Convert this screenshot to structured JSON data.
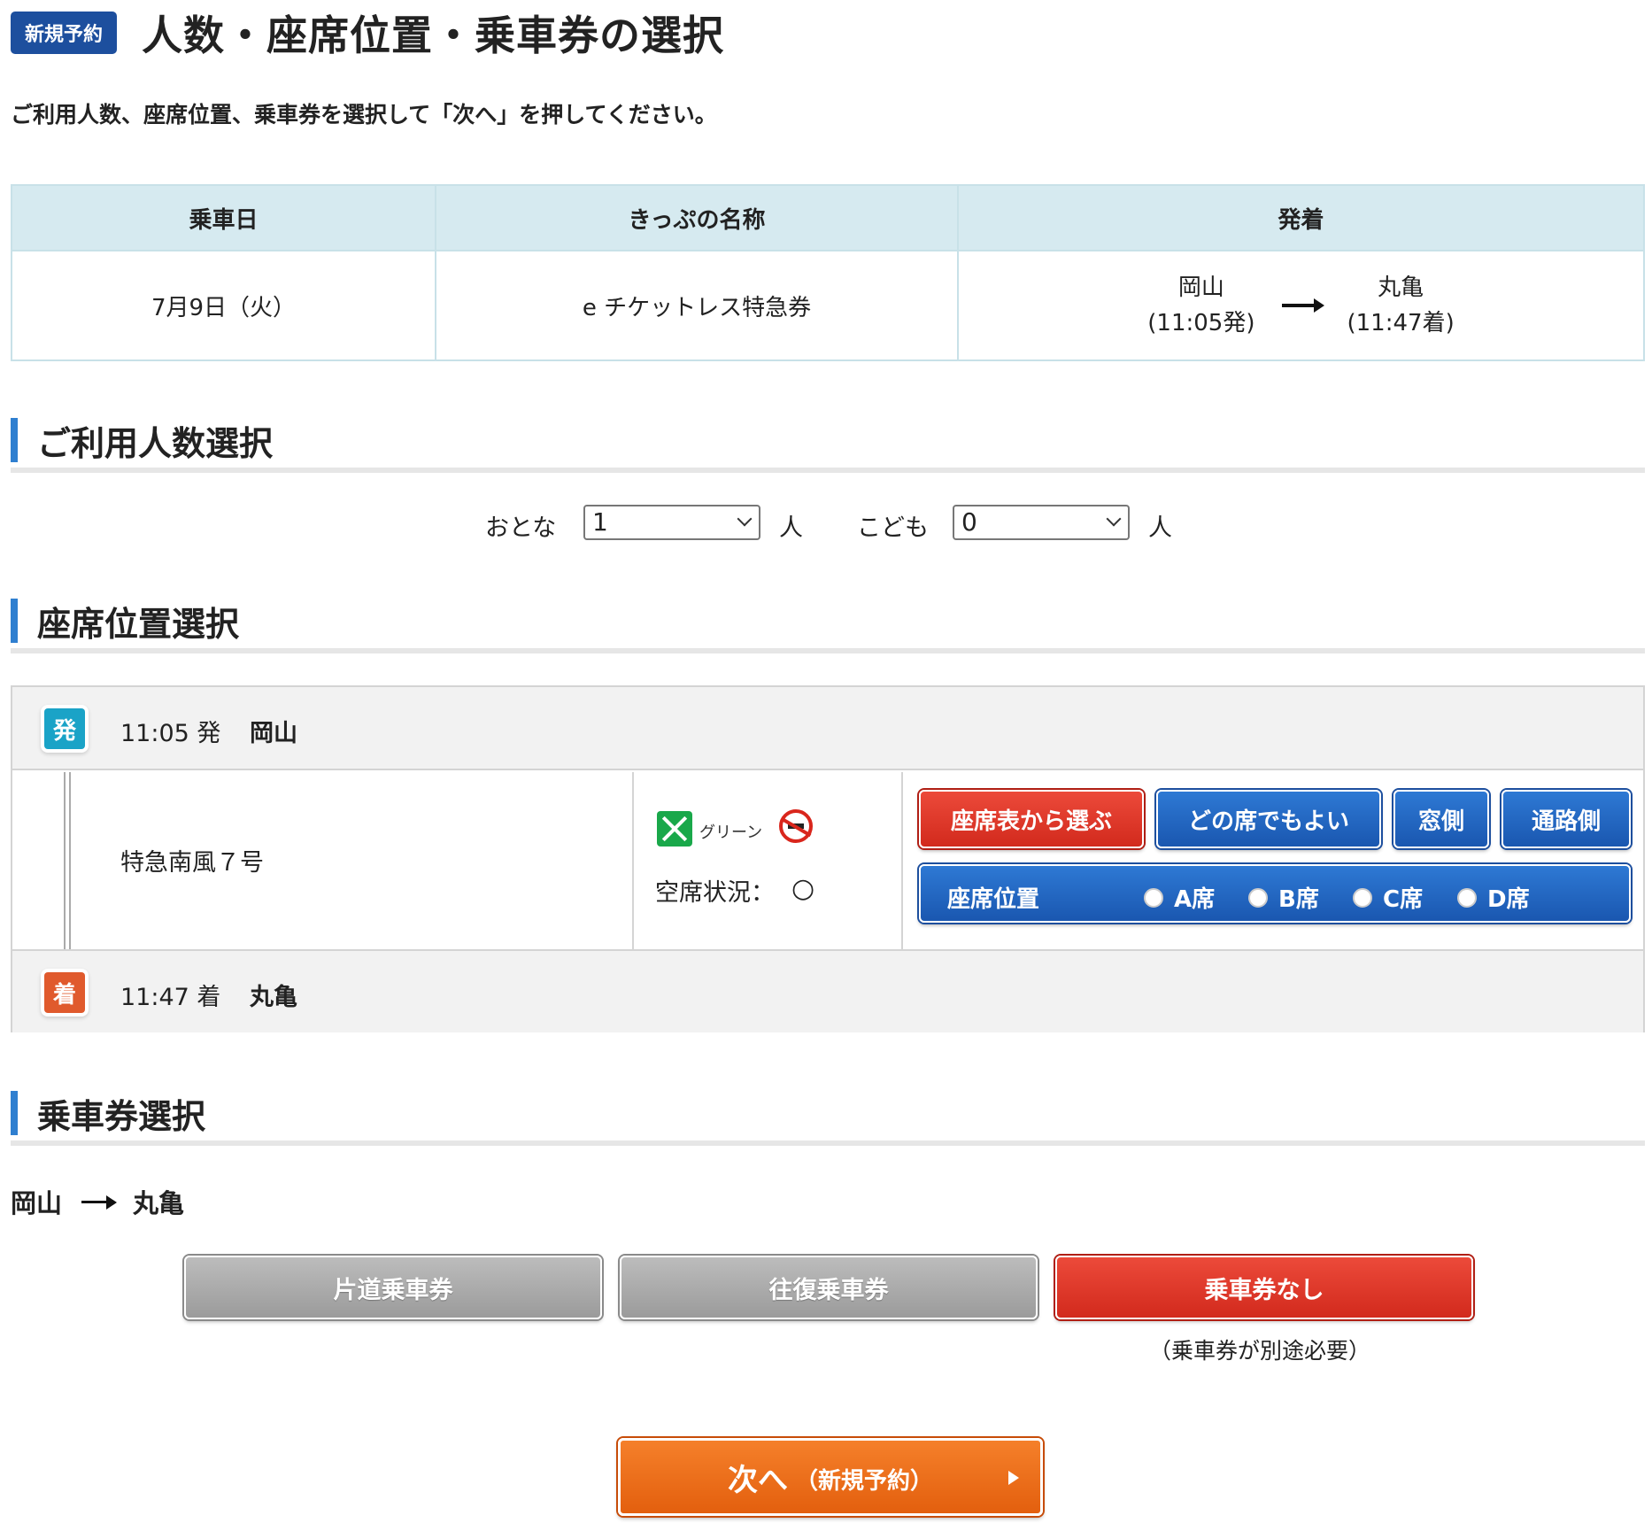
{
  "header": {
    "badge": "新規予約",
    "title": "人数・座席位置・乗車券の選択"
  },
  "instruction": "ご利用人数、座席位置、乗車券を選択して「次へ」を押してください。",
  "summary": {
    "headers": [
      "乗車日",
      "きっぷの名称",
      "発着"
    ],
    "date": "7月9日（火）",
    "ticket_name": "e チケットレス特急券",
    "from": {
      "station": "岡山",
      "time": "(11:05発)"
    },
    "to": {
      "station": "丸亀",
      "time": "(11:47着)"
    }
  },
  "passengers": {
    "heading": "ご利用人数選択",
    "adult_label": "おとな",
    "adult_value": "1",
    "child_label": "こども",
    "child_value": "0",
    "unit": "人"
  },
  "seat": {
    "heading": "座席位置選択",
    "departure": {
      "badge": "発",
      "time": "11:05 発",
      "station": "岡山"
    },
    "arrival": {
      "badge": "着",
      "time": "11:47 着",
      "station": "丸亀"
    },
    "train": "特急南風７号",
    "car_class": "グリーン",
    "vacancy_label": "空席状況：",
    "vacancy_mark": "○",
    "buttons": [
      "座席表から選ぶ",
      "どの席でもよい",
      "窓側",
      "通路側"
    ],
    "seat_position": {
      "label": "座席位置",
      "options": [
        "A席",
        "B席",
        "C席",
        "D席"
      ]
    }
  },
  "ticket": {
    "heading": "乗車券選択",
    "from": "岡山",
    "to": "丸亀",
    "buttons": [
      "片道乗車券",
      "往復乗車券",
      "乗車券なし"
    ],
    "note": "（乗車券が別途必要）"
  },
  "next": {
    "label": "次へ",
    "sub": "（新規予約）"
  },
  "colors": {
    "accent_blue": "#1d4f9e",
    "button_red": "#d22a1d",
    "next_orange": "#f5802a",
    "table_header": "#d6eaf0"
  }
}
